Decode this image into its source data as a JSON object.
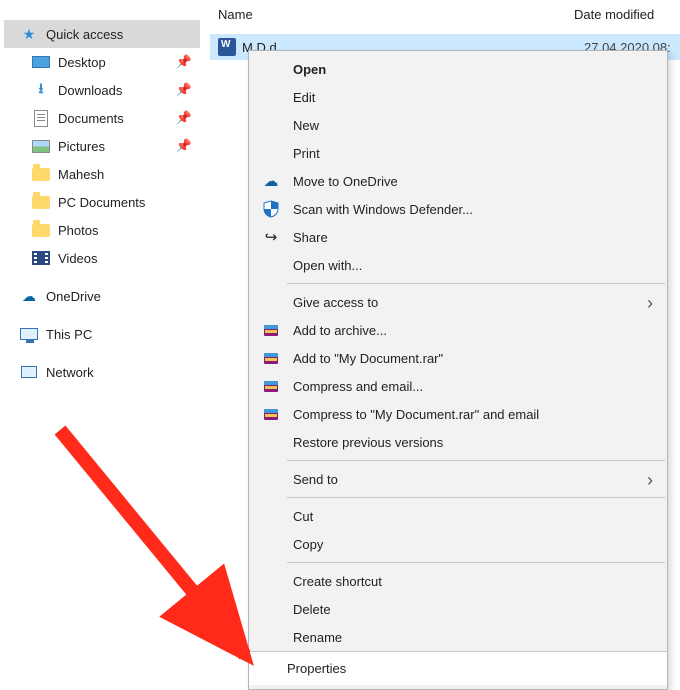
{
  "columns": {
    "name": "Name",
    "date": "Date modified"
  },
  "file": {
    "name": "M   D                  d",
    "date": "27.04.2020 08:"
  },
  "sidebar": {
    "items": [
      {
        "label": "Quick access",
        "icon": "star",
        "root": true,
        "selected": true,
        "pinned": false
      },
      {
        "label": "Desktop",
        "icon": "desktop",
        "root": false,
        "selected": false,
        "pinned": true
      },
      {
        "label": "Downloads",
        "icon": "download",
        "root": false,
        "selected": false,
        "pinned": true
      },
      {
        "label": "Documents",
        "icon": "doc",
        "root": false,
        "selected": false,
        "pinned": true
      },
      {
        "label": "Pictures",
        "icon": "pic",
        "root": false,
        "selected": false,
        "pinned": true
      },
      {
        "label": "Mahesh",
        "icon": "folder",
        "root": false,
        "selected": false,
        "pinned": false
      },
      {
        "label": "PC Documents",
        "icon": "folder",
        "root": false,
        "selected": false,
        "pinned": false
      },
      {
        "label": "Photos",
        "icon": "folder",
        "root": false,
        "selected": false,
        "pinned": false
      },
      {
        "label": "Videos",
        "icon": "video",
        "root": false,
        "selected": false,
        "pinned": false
      }
    ],
    "onedrive": "OneDrive",
    "thispc": "This PC",
    "network": "Network"
  },
  "menu": {
    "open": "Open",
    "edit": "Edit",
    "new": "New",
    "print": "Print",
    "onedrive": "Move to OneDrive",
    "defender": "Scan with Windows Defender...",
    "share": "Share",
    "openwith": "Open with...",
    "giveaccess": "Give access to",
    "addarchive": "Add to archive...",
    "addrar": "Add to \"My Document.rar\"",
    "compressemail": "Compress and email...",
    "compressraremail": "Compress to \"My Document.rar\" and email",
    "restore": "Restore previous versions",
    "sendto": "Send to",
    "cut": "Cut",
    "copy": "Copy",
    "shortcut": "Create shortcut",
    "delete": "Delete",
    "rename": "Rename",
    "properties": "Properties"
  },
  "accent": "#ff2a1a"
}
